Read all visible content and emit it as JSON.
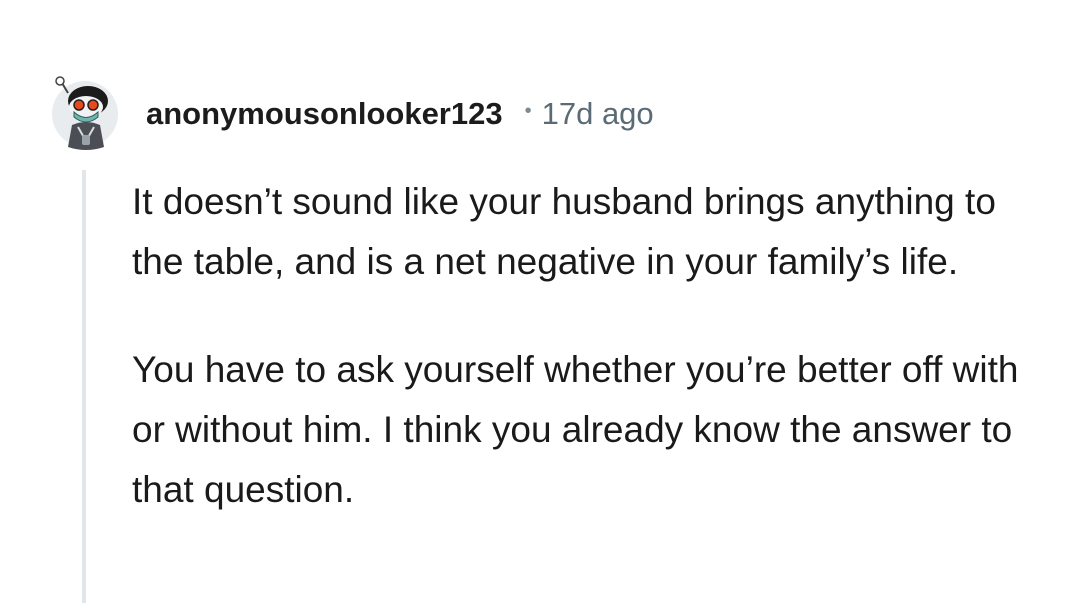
{
  "comment": {
    "author": "anonymousonlooker123",
    "separator": "•",
    "timestamp": "17d ago",
    "avatar_icon": "snoo-avatar-icon",
    "paragraphs": [
      "It doesn’t sound like your husband brings anything to the table, and is a net negative in your family’s life.",
      "You have to ask yourself whether you’re better off with or without him. I think you already know the answer to that question."
    ]
  },
  "colors": {
    "background": "#ffffff",
    "text": "#1a1a1b",
    "meta": "#5b6b76",
    "thread_line": "#e3e6e8"
  }
}
